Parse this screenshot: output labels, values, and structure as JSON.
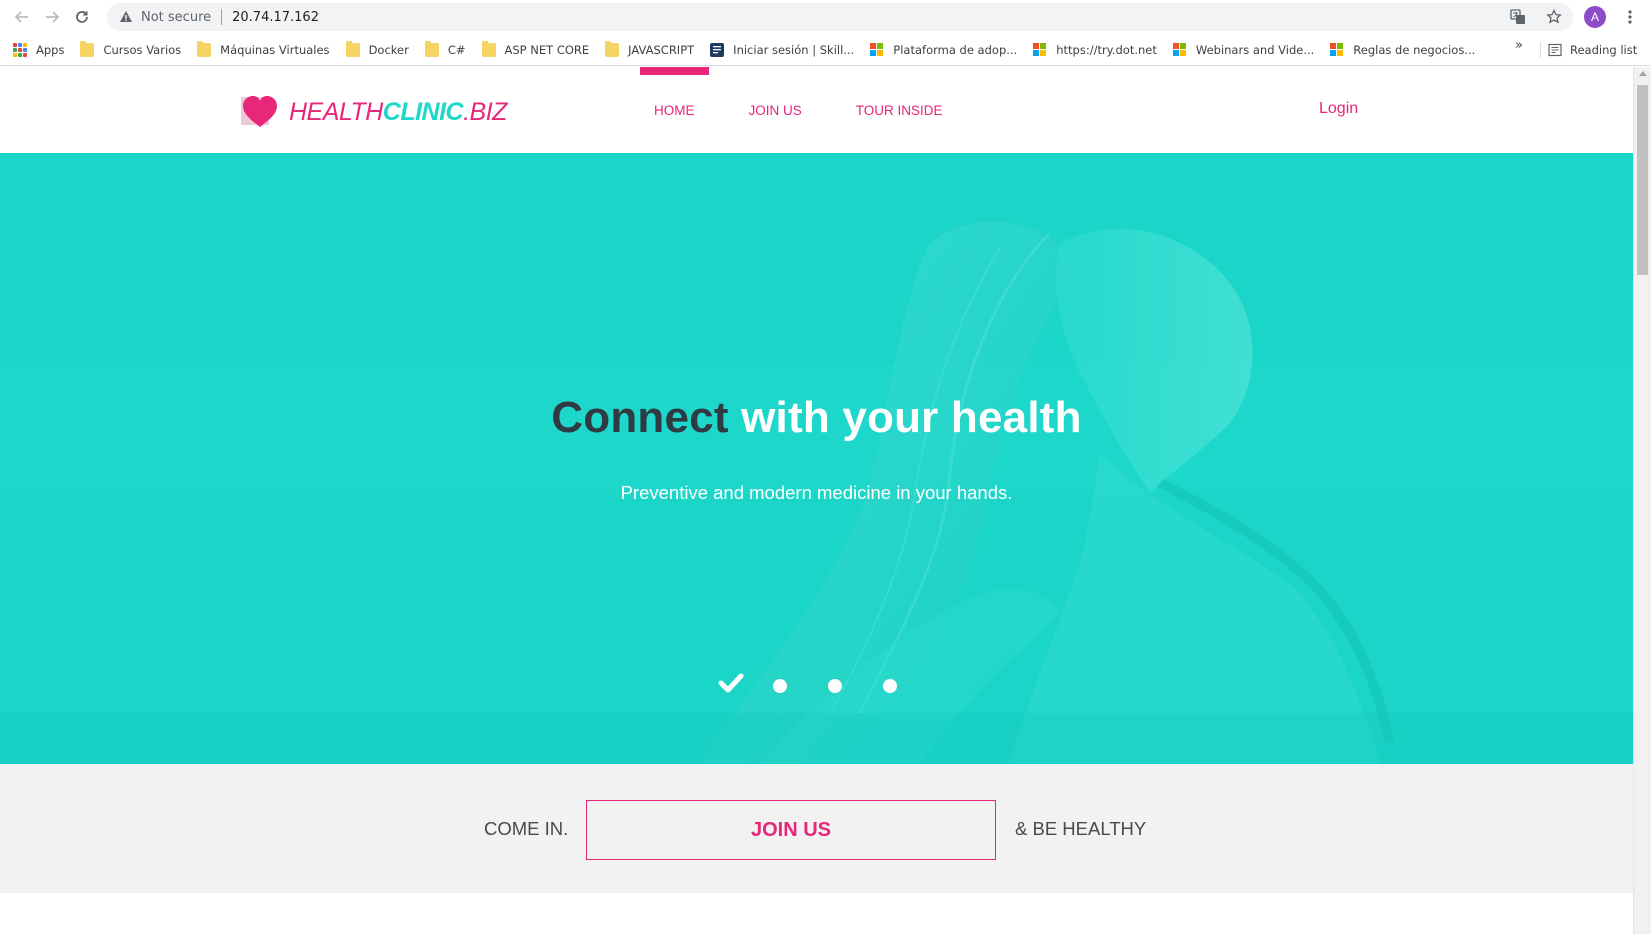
{
  "browser": {
    "security_label": "Not secure",
    "url": "20.74.17.162",
    "profile_initial": "A",
    "bookmarks": [
      {
        "label": "Apps",
        "icon": "apps-grid-icon"
      },
      {
        "label": "Cursos Varios",
        "icon": "folder-icon"
      },
      {
        "label": "Máquinas Virtuales",
        "icon": "folder-icon"
      },
      {
        "label": "Docker",
        "icon": "folder-icon"
      },
      {
        "label": "C#",
        "icon": "folder-icon"
      },
      {
        "label": "ASP NET CORE",
        "icon": "folder-icon"
      },
      {
        "label": "JAVASCRIPT",
        "icon": "folder-icon"
      },
      {
        "label": "Iniciar sesión | Skill...",
        "icon": "document-icon"
      },
      {
        "label": "Plataforma de adop...",
        "icon": "microsoft-logo-icon"
      },
      {
        "label": "https://try.dot.net",
        "icon": "microsoft-logo-icon"
      },
      {
        "label": "Webinars and Vide...",
        "icon": "microsoft-logo-icon"
      },
      {
        "label": "Reglas de negocios...",
        "icon": "microsoft-logo-icon"
      }
    ],
    "overflow_label": "»",
    "reading_list_label": "Reading list"
  },
  "site": {
    "brand": {
      "part1": "HEALTH",
      "part2": "CLINIC",
      "part3": ".BIZ"
    },
    "menu": [
      {
        "label": "HOME",
        "active": true
      },
      {
        "label": "JOIN US",
        "active": false
      },
      {
        "label": "TOUR INSIDE",
        "active": false
      }
    ],
    "login_label": "Login"
  },
  "hero": {
    "title_dark": "Connect",
    "title_light": " with your health",
    "subtitle": "Preventive and modern medicine in your hands.",
    "slides_count": 4,
    "active_slide": 1
  },
  "join_band": {
    "come_in": "COME IN.",
    "button_label": "JOIN US",
    "be_healthy": "& BE HEALTHY"
  },
  "colors": {
    "brand_pink": "#e8267a",
    "brand_teal": "#1bd6c8",
    "dark_text": "#2f3a43"
  }
}
